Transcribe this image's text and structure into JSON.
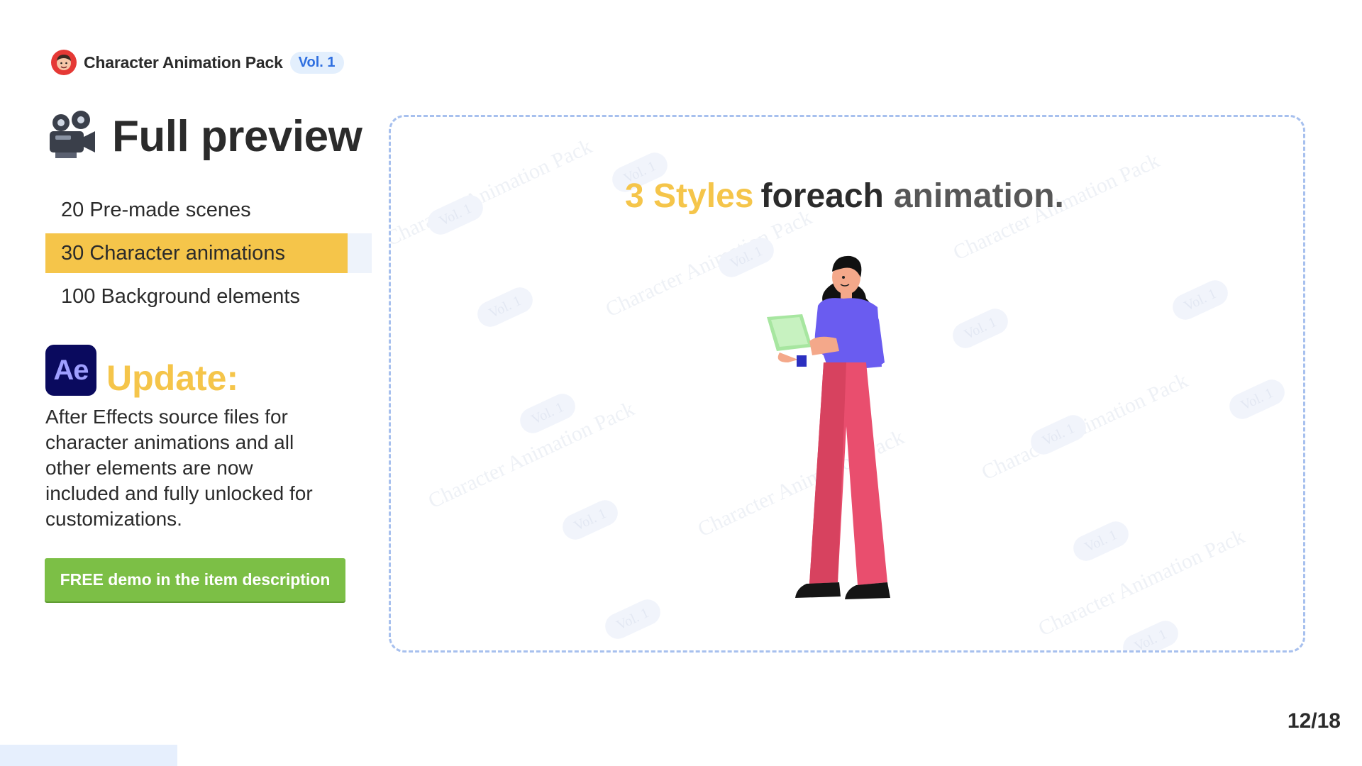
{
  "brand": {
    "title": "Character Animation Pack",
    "badge": "Vol. 1"
  },
  "heading": {
    "title": "Full preview"
  },
  "features": [
    {
      "label": "20 Pre-made scenes",
      "active": false
    },
    {
      "label": "30 Character animations",
      "active": true
    },
    {
      "label": "100 Background elements",
      "active": false
    }
  ],
  "update": {
    "logo": "Ae",
    "title": "Update:",
    "description": "After Effects source files for character animations and all other elements are now included and fully unlocked for customizations."
  },
  "cta": {
    "label": "FREE demo in the item description"
  },
  "preview": {
    "caption_highlight": "3 Styles",
    "caption_main": "foreach",
    "caption_blur": "animation.",
    "watermark_text": "Character Animation Pack",
    "watermark_badge": "Vol. 1"
  },
  "pagination": {
    "counter": "12/18"
  },
  "progress": {
    "fraction": 0.13
  },
  "icons": {
    "brand": "character-face-icon",
    "heading": "movie-camera-icon",
    "update": "after-effects-icon"
  },
  "colors": {
    "accent_yellow": "#f5c54a",
    "cta_green": "#7cbf46",
    "badge_bg": "#e3effd",
    "badge_text": "#2f6fe0",
    "frame_dash": "#a7c0ee",
    "ae_bg": "#0a0a5e"
  }
}
